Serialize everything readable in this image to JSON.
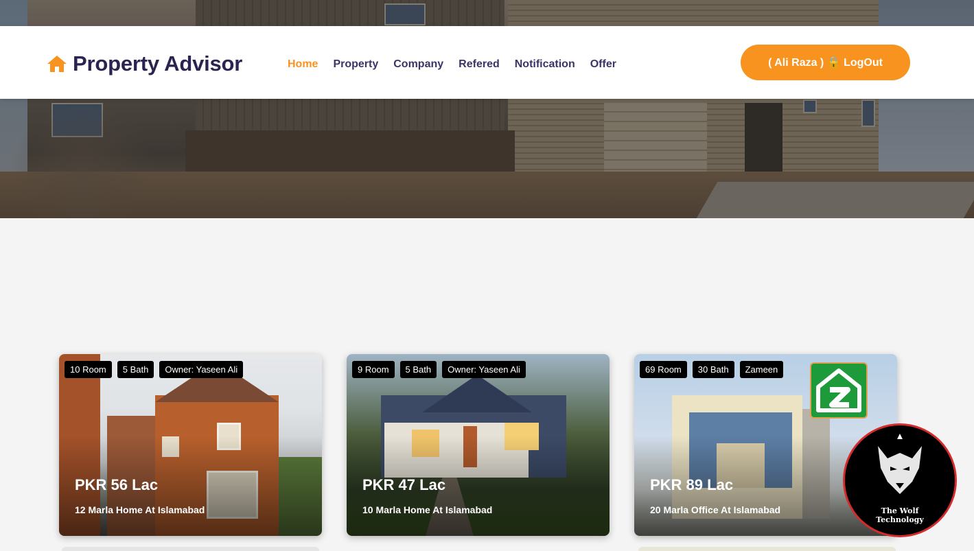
{
  "brand": {
    "title": "Property Advisor",
    "icon": "home-icon"
  },
  "nav": {
    "items": [
      {
        "label": "Home",
        "active": true
      },
      {
        "label": "Property",
        "active": false
      },
      {
        "label": "Company",
        "active": false
      },
      {
        "label": "Refered",
        "active": false
      },
      {
        "label": "Notification",
        "active": false
      },
      {
        "label": "Offer",
        "active": false
      }
    ],
    "logout_label": "( Ali Raza ) 🔒 LogOut"
  },
  "colors": {
    "accent": "#f7931e",
    "nav_text": "#3c3466",
    "brand_text": "#2b2450",
    "badge_bg": "#000000"
  },
  "listings": [
    {
      "badges": [
        "10 Room",
        "5 Bath",
        "Owner: Yaseen Ali"
      ],
      "price": "PKR 56 Lac",
      "description": "12 Marla Home At Islamabad"
    },
    {
      "badges": [
        "9 Room",
        "5 Bath",
        "Owner: Yaseen Ali"
      ],
      "price": "PKR 47 Lac",
      "description": "10 Marla Home At Islamabad"
    },
    {
      "badges": [
        "69 Room",
        "30 Bath",
        "Zameen"
      ],
      "price": "PKR 89 Lac",
      "description": "20 Marla Office At Islamabad"
    }
  ],
  "watermark": {
    "text_line1": "The Wolf",
    "text_line2": "Technology"
  }
}
